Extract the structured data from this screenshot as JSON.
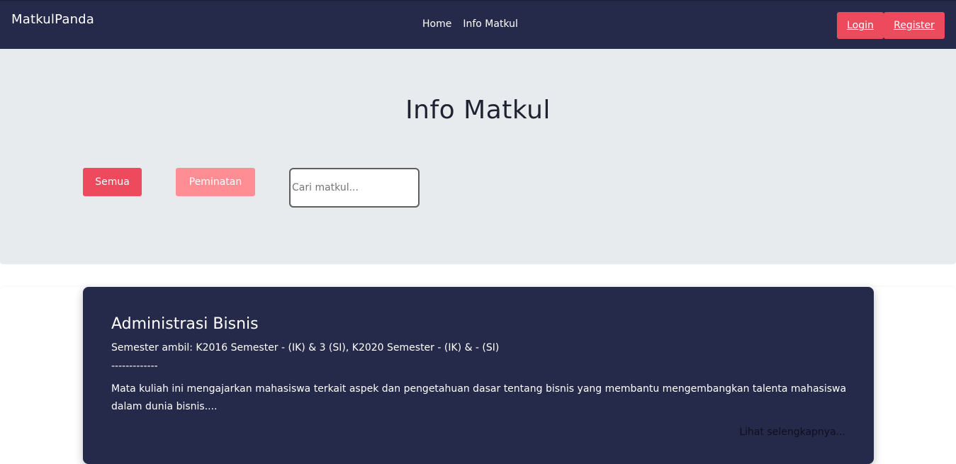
{
  "navbar": {
    "brand": "MatkulPanda",
    "links": [
      "Home",
      "Info Matkul"
    ],
    "login_label": "Login",
    "register_label": "Register"
  },
  "hero": {
    "title": "Info Matkul",
    "filters": {
      "all_label": "Semua",
      "specialization_label": "Peminatan"
    },
    "search": {
      "placeholder": "Cari matkul...",
      "value": ""
    }
  },
  "courses": [
    {
      "title": "Administrasi Bisnis",
      "semester": "Semester ambil: K2016 Semester - (IK) & 3 (SI), K2020 Semester - (IK) & - (SI)",
      "divider": "-------------",
      "description": "Mata kuliah ini mengajarkan mahasiswa terkait aspek dan pengetahuan dasar tentang bisnis yang membantu mengembangkan talenta mahasiswa dalam dunia bisnis....",
      "more_label": "Lihat selengkapnya..."
    }
  ],
  "colors": {
    "navy": "#262a4a",
    "accent_red": "#ee4a5d",
    "accent_pink": "#ff8e94",
    "hero_bg": "#e8ebee"
  }
}
